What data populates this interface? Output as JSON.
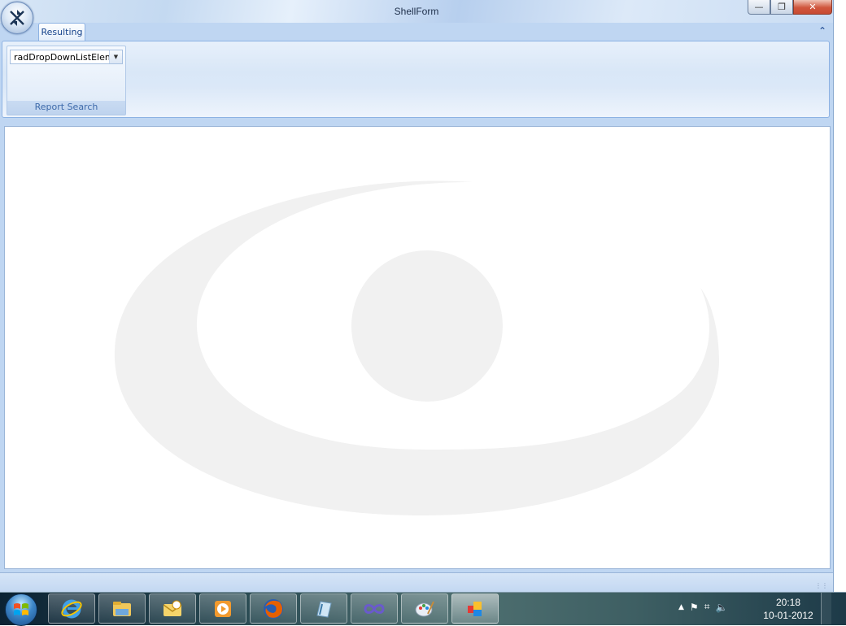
{
  "window": {
    "title": "ShellForm",
    "minimize_glyph": "—",
    "maximize_glyph": "❐",
    "close_glyph": "✕"
  },
  "ribbon": {
    "tab_label": "Resulting",
    "collapse_glyph": "⌃",
    "group": {
      "dropdown_value": "radDropDownListElem",
      "dropdown_arrow": "▼",
      "label": "Report Search"
    }
  },
  "taskbar": {
    "apps": [
      {
        "icon": "internet-explorer-icon"
      },
      {
        "icon": "windows-explorer-icon"
      },
      {
        "icon": "outlook-icon"
      },
      {
        "icon": "media-player-icon"
      },
      {
        "icon": "firefox-icon"
      },
      {
        "icon": "notepad-icon"
      },
      {
        "icon": "visual-studio-icon"
      },
      {
        "icon": "paint-icon"
      },
      {
        "icon": "shellform-app-icon"
      }
    ],
    "tray": {
      "show_hidden_glyph": "▲",
      "flag_glyph": "⚑",
      "network_glyph": "⌗",
      "volume_glyph": "🔈"
    },
    "clock_time": "20:18",
    "clock_date": "10-01-2012"
  },
  "colors": {
    "ribbon_blue": "#bfd6f2",
    "tab_text": "#15428b",
    "group_label": "#3e6aaa",
    "watermark": "#f1f1f1"
  }
}
